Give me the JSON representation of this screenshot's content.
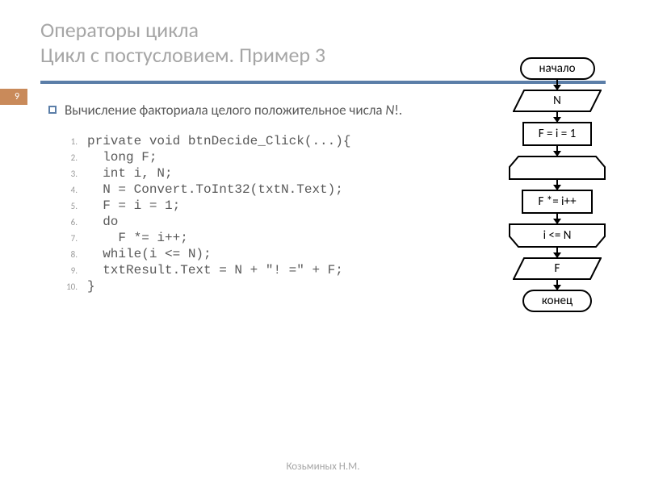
{
  "title": {
    "line1": "Операторы цикла",
    "line2": "Цикл с постусловием. Пример 3"
  },
  "page_number": "9",
  "description": {
    "prefix": "Вычисление факториала целого положительное числа ",
    "var": "N",
    "suffix": "!."
  },
  "code": [
    "private void btnDecide_Click(...){",
    "  long F;",
    "  int i, N;",
    "  N = Convert.ToInt32(txtN.Text);",
    "  F = i = 1;",
    "  do",
    "    F *= i++;",
    "  while(i <= N);",
    "  txtResult.Text = N + \"! =\" + F;",
    "}"
  ],
  "flowchart": {
    "start": "начало",
    "input": "N",
    "init": "F = i = 1",
    "body": "F *= i++",
    "cond": "i <= N",
    "output": "F",
    "end": "конец"
  },
  "footer": "Козьминых Н.М."
}
